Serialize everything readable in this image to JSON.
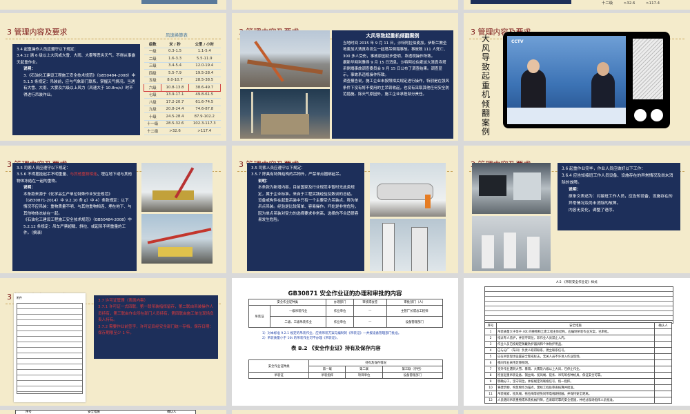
{
  "common": {
    "section_title": "3  管理内容及要求"
  },
  "top_strip": {
    "wind_row_level": "十二级",
    "wind_row_speed": ">32.6",
    "wind_row_kmh": ">117.4"
  },
  "slide1": {
    "lines": [
      "3.4  起重操作人员应遵守以下规定：",
      "3.4.12  遇 6 级以上大风或大雪、大雨、大雾等恶劣天气，不得从事露天起重作业。"
    ],
    "note_label": "说明：",
    "note": [
      "3.《石油化工建设工程施工安全技术规范》（GB50484-2008）中 5.1.5 条规定：吊装前，应与气象部门联系，掌握天气情况。当遇有大雪、大雨、大雾及六级以上风力（风速大于 10.8m/s）时不得进行吊装作业。"
    ],
    "wind_title": "风速换算表",
    "wind_header": [
      "级数",
      "米 / 秒",
      "公里 / 小时"
    ],
    "wind_rows": [
      [
        "零级",
        "0-0.2",
        "<1"
      ],
      [
        "一级",
        "0.3-1.5",
        "1.1-5.4"
      ],
      [
        "二级",
        "1.6-3.3",
        "5.5-11.9"
      ],
      [
        "三级",
        "3.4-5.4",
        "12.0-19.4"
      ],
      [
        "四级",
        "5.5-7.9",
        "19.5-28.4"
      ],
      [
        "五级",
        "8.0-10.7",
        "28.5-38.5"
      ],
      [
        "六级",
        "10.8-13.8",
        "38.6-49.7"
      ],
      [
        "七级",
        "13.9-17.1",
        "49.8-61.5"
      ],
      [
        "八级",
        "17.2-20.7",
        "61.6-74.5"
      ],
      [
        "九级",
        "20.8-24.4",
        "74.6-87.8"
      ],
      [
        "十级",
        "24.5-28.4",
        "87.9-102.2"
      ],
      [
        "十一级",
        "28.5-32.6",
        "102.3-117.3"
      ],
      [
        "十二级",
        ">32.6",
        ">117.4"
      ]
    ],
    "highlight_level": "六级"
  },
  "slide2": {
    "case_title": "大风导致起重机倾翻案例",
    "paragraphs": [
      "当地时间 2015 年 9 月 11 日，沙特阿拉伯麦加，伊斯兰教圣地麦加大清真寺发生一起塔吊倒塌事故。事故致 111 人死亡、300 多人受伤，事故原因初步查明，系透视操作所致。",
      "据新华网利雅得 9 月 15 日消息，沙特阿拉伯麦加大清真寺塔吊倒塌事故调查委员会 9 月 15 日公布了调查结果。调查显示，事故系违规操作所致。",
      "调查报告说，施工企业未按照相关规定进行操作，特别是在强风条件下没有将不使用的主吊臂收起，也没有采取其他任何安全防范措施。除天气原因外，施工企业承担部分责任。"
    ]
  },
  "slide3": {
    "vertical_title": "大风导致起重机倾翻案例",
    "tv_caption": "CCTV"
  },
  "slide4": {
    "lines": [
      "3.5  司索人员应遵守以下规定：",
      "3.5.6  不得捆挂起吊不明重量、与其他重物相连、埋在地下或与其他物体冻结在一起的重物。"
    ],
    "red_phrase_1": "与其他重物相连",
    "red_phrase_2": "其他",
    "note_label": "说明：",
    "note": [
      "本条款来源于《化学品生产单位特殊作业安全规范》（GB30871-2014）中 9.2.10 条 g）中 4）条款规定：以下情况不应吊装：重物质量不明、与其他重物相连、埋在地下、与其他物体冻结在一起。",
      "《石油化工建设工程施工安全技术规范》（GB50484-2008）中 5.2.12 条规定：吊车严禁超载、斜拉、或起吊不明重量的工件。（摘录）"
    ]
  },
  "slide5": {
    "lines": [
      "3.5  司索人员应遵守以下规定：",
      "3.5.7  除具有特殊结构的吊物外，严禁单点捆绑起吊。"
    ],
    "note_label": "说明：",
    "note": [
      "本条款为新增内容，目前国家及行业规范中暂时无此类规定，属于企业标准。来自于工程实践经验及数训的总结。",
      "设备或构件在起重吊装中只有一个主要受力吊装点，称为单吊点吊装。经验是比较简单、容易操作。坏处是非常危险，因为单点吊装对受力的选择要求非常高，选择的不合适很容易发生危险。"
    ]
  },
  "slide6": {
    "lines": [
      "3.6  起重作业完毕，作业人员应做好以下工作：",
      "3.6.4  应告知接班工作人员设备、设施存在的异常情况及尚未消除的故障。"
    ],
    "note_label": "说明：",
    "note": [
      "原条文表述为：对接班工作人员，应告知设备、设施存在的异常情况及尚未消除的故障。",
      "内容无变化，调整了语序。"
    ]
  },
  "slide7": {
    "red_lines": [
      "3.7  许可证管理（表面内容）",
      "3.7.1  许可证一式四联，第一联吊装指挥留存，第二联由吊装操作人员持有，第三联由作业所在部门人员持有，第四联由施工单位现场负责人持有。",
      "3.7.2  需要作业前签字，许可证后经安全部门统一存档，保存日期：保存期限至少 1 年。"
    ],
    "form_heading": "附件"
  },
  "slide8": {
    "title": "GB30871 安全作业证的办理和审批的内容",
    "t1_header": [
      "安全作业证种类",
      "办理部门",
      "审核或会签",
      "审批部门（人）"
    ],
    "t1_kind": "吊装证",
    "t1_rows": [
      [
        "一级吊装作业",
        "作业单位",
        "—",
        "主管厂长或总工程师"
      ],
      [
        "二级、三级吊装作业",
        "作业单位",
        "—",
        "设备管理部门"
      ]
    ],
    "notes": [
      "1）对本标准 9.2.1 规定的吊装作业，应将吊装方案与编制的《吊装证》一并报设备管理部门批准。",
      "2）吊装质量小于 10t 的吊装作业可不办理《吊装证》。"
    ],
    "t2_title": "表 B.2 《安全作业证》持有及保存内容",
    "t2_header": [
      "安全作业证种类",
      "持有及保存情况"
    ],
    "t2_sub": [
      "第一联",
      "第二联",
      "第三联（存档）"
    ],
    "t2_row": [
      "吊装证",
      "吊装指挥",
      "项目单位",
      "设备管理部门"
    ]
  },
  "slide9": {
    "form_title": "A.5 《吊装安全作业证》样式",
    "num_label": "序号",
    "measure_label": "安全措施",
    "confirm_label": "确认人",
    "items": [
      "吊装质量大于等于 40t 的重物和土建工程主体结构，应编制吊装作业方案，已审批。",
      "指派专人监护，并监守岗位，非作业人员禁止入内。",
      "作业人员已按规定佩戴防护器具和个体防护用品。",
      "已与分厂（车间）负责人取得联系，建立联系信号。",
      "已在吊装现场设置安全警戒标志，无关人员不许进入作业现场。",
      "夜间作业采用足够照明。",
      "室外作业遇到大雪、暴雨、大雾及六级以上大风，已停止作业。",
      "检查起重吊装设备、钢丝绳、揽风绳、链条、吊钩等各种机具，保证安全可靠。",
      "明确分工，坚守岗位，并按规定的联络信号，统一指挥。",
      "将建筑物、构筑物作为锚点，需经工程处审查核算并批准。",
      "吊装绳索、揽风绳、拖拉绳等避免同带电线路接触，并保持安全距离。",
      "人员随同吊装重物或吊装机械升降，应采取可靠的安全措施，并经过现场指挥人员批准。"
    ]
  },
  "bottom_strip": {
    "num_label": "序号",
    "measure_label": "安全措施",
    "confirm_label": "确认人"
  }
}
